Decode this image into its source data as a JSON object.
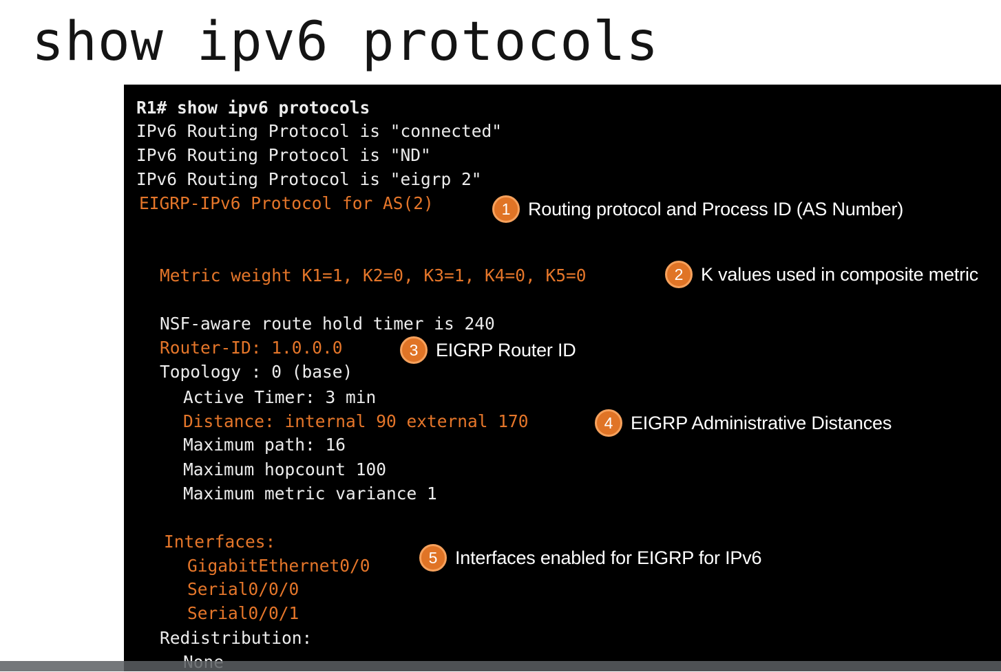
{
  "title": "show ipv6 protocols",
  "colors": {
    "accent": "#e5762a",
    "terminal_bg": "#000000",
    "terminal_text": "#ececec"
  },
  "terminal": {
    "lines": [
      "R1# show ipv6 protocols",
      "IPv6 Routing Protocol is \"connected\"",
      "IPv6 Routing Protocol is \"ND\"",
      "IPv6 Routing Protocol is \"eigrp 2\"",
      "EIGRP-IPv6 Protocol for AS(2)",
      "Metric weight K1=1, K2=0, K3=1, K4=0, K5=0",
      "NSF-aware route hold timer is 240",
      "Router-ID: 1.0.0.0",
      "Topology : 0 (base)",
      "Active Timer: 3 min",
      "Distance: internal 90 external 170",
      "Maximum path: 16",
      "Maximum hopcount 100",
      "Maximum metric variance 1",
      "Interfaces:",
      "GigabitEthernet0/0",
      "Serial0/0/0",
      "Serial0/0/1",
      "Redistribution:",
      "None"
    ]
  },
  "callouts": [
    {
      "number": "1",
      "text": "Routing protocol and Process ID (AS Number)"
    },
    {
      "number": "2",
      "text": "K values used in composite metric"
    },
    {
      "number": "3",
      "text": "EIGRP Router ID"
    },
    {
      "number": "4",
      "text": "EIGRP Administrative Distances"
    },
    {
      "number": "5",
      "text": "Interfaces enabled for EIGRP for IPv6"
    }
  ]
}
